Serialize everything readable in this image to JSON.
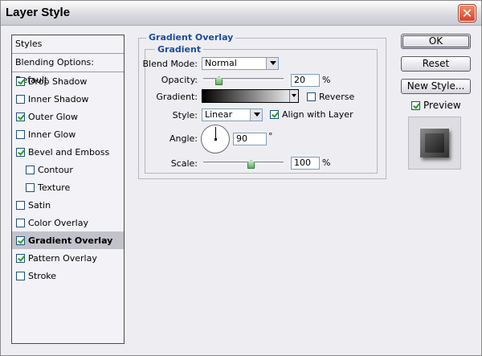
{
  "window": {
    "title": "Layer Style",
    "close_glyph": "✕"
  },
  "styles_list": {
    "header": "Styles",
    "blending": "Blending Options: Default",
    "items": [
      {
        "label": "Drop Shadow",
        "checked": true,
        "sub": false,
        "selected": false
      },
      {
        "label": "Inner Shadow",
        "checked": false,
        "sub": false,
        "selected": false
      },
      {
        "label": "Outer Glow",
        "checked": true,
        "sub": false,
        "selected": false
      },
      {
        "label": "Inner Glow",
        "checked": false,
        "sub": false,
        "selected": false
      },
      {
        "label": "Bevel and Emboss",
        "checked": true,
        "sub": false,
        "selected": false
      },
      {
        "label": "Contour",
        "checked": false,
        "sub": true,
        "selected": false
      },
      {
        "label": "Texture",
        "checked": false,
        "sub": true,
        "selected": false
      },
      {
        "label": "Satin",
        "checked": false,
        "sub": false,
        "selected": false
      },
      {
        "label": "Color Overlay",
        "checked": false,
        "sub": false,
        "selected": false
      },
      {
        "label": "Gradient Overlay",
        "checked": true,
        "sub": false,
        "selected": true
      },
      {
        "label": "Pattern Overlay",
        "checked": true,
        "sub": false,
        "selected": false
      },
      {
        "label": "Stroke",
        "checked": false,
        "sub": false,
        "selected": false
      }
    ]
  },
  "panel": {
    "group_title": "Gradient Overlay",
    "subgroup_title": "Gradient",
    "blend_mode": {
      "label": "Blend Mode:",
      "value": "Normal"
    },
    "opacity": {
      "label": "Opacity:",
      "value": "20",
      "unit": "%",
      "level": 0.2
    },
    "gradient": {
      "label": "Gradient:",
      "from_color": "#000000",
      "to_color": "#ffffff"
    },
    "reverse": {
      "label": "Reverse",
      "checked": false
    },
    "style": {
      "label": "Style:",
      "value": "Linear"
    },
    "align_with_layer": {
      "label": "Align with Layer",
      "checked": true
    },
    "angle": {
      "label": "Angle:",
      "value": "90",
      "unit": "°"
    },
    "scale": {
      "label": "Scale:",
      "value": "100",
      "unit": "%",
      "level": 0.6
    }
  },
  "buttons": {
    "ok": "OK",
    "reset": "Reset",
    "new_style": "New Style..."
  },
  "preview": {
    "label": "Preview",
    "checked": true
  },
  "colors": {
    "accent": "#1a4d9c",
    "check": "#21a121",
    "selected_row": "#c2c2cc"
  }
}
